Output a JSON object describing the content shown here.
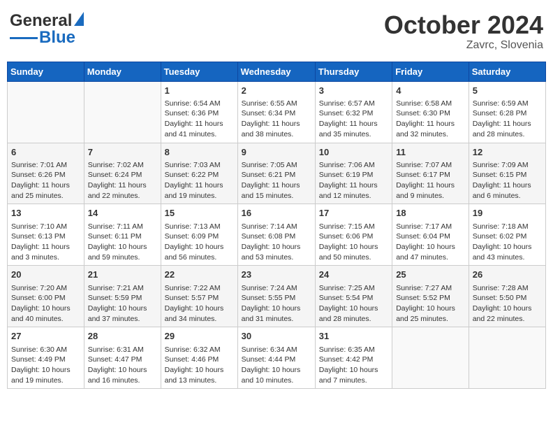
{
  "header": {
    "logo_general": "General",
    "logo_blue": "Blue",
    "month_title": "October 2024",
    "location": "Zavrc, Slovenia"
  },
  "days_of_week": [
    "Sunday",
    "Monday",
    "Tuesday",
    "Wednesday",
    "Thursday",
    "Friday",
    "Saturday"
  ],
  "weeks": [
    [
      {
        "day": "",
        "info": ""
      },
      {
        "day": "",
        "info": ""
      },
      {
        "day": "1",
        "info": "Sunrise: 6:54 AM\nSunset: 6:36 PM\nDaylight: 11 hours and 41 minutes."
      },
      {
        "day": "2",
        "info": "Sunrise: 6:55 AM\nSunset: 6:34 PM\nDaylight: 11 hours and 38 minutes."
      },
      {
        "day": "3",
        "info": "Sunrise: 6:57 AM\nSunset: 6:32 PM\nDaylight: 11 hours and 35 minutes."
      },
      {
        "day": "4",
        "info": "Sunrise: 6:58 AM\nSunset: 6:30 PM\nDaylight: 11 hours and 32 minutes."
      },
      {
        "day": "5",
        "info": "Sunrise: 6:59 AM\nSunset: 6:28 PM\nDaylight: 11 hours and 28 minutes."
      }
    ],
    [
      {
        "day": "6",
        "info": "Sunrise: 7:01 AM\nSunset: 6:26 PM\nDaylight: 11 hours and 25 minutes."
      },
      {
        "day": "7",
        "info": "Sunrise: 7:02 AM\nSunset: 6:24 PM\nDaylight: 11 hours and 22 minutes."
      },
      {
        "day": "8",
        "info": "Sunrise: 7:03 AM\nSunset: 6:22 PM\nDaylight: 11 hours and 19 minutes."
      },
      {
        "day": "9",
        "info": "Sunrise: 7:05 AM\nSunset: 6:21 PM\nDaylight: 11 hours and 15 minutes."
      },
      {
        "day": "10",
        "info": "Sunrise: 7:06 AM\nSunset: 6:19 PM\nDaylight: 11 hours and 12 minutes."
      },
      {
        "day": "11",
        "info": "Sunrise: 7:07 AM\nSunset: 6:17 PM\nDaylight: 11 hours and 9 minutes."
      },
      {
        "day": "12",
        "info": "Sunrise: 7:09 AM\nSunset: 6:15 PM\nDaylight: 11 hours and 6 minutes."
      }
    ],
    [
      {
        "day": "13",
        "info": "Sunrise: 7:10 AM\nSunset: 6:13 PM\nDaylight: 11 hours and 3 minutes."
      },
      {
        "day": "14",
        "info": "Sunrise: 7:11 AM\nSunset: 6:11 PM\nDaylight: 10 hours and 59 minutes."
      },
      {
        "day": "15",
        "info": "Sunrise: 7:13 AM\nSunset: 6:09 PM\nDaylight: 10 hours and 56 minutes."
      },
      {
        "day": "16",
        "info": "Sunrise: 7:14 AM\nSunset: 6:08 PM\nDaylight: 10 hours and 53 minutes."
      },
      {
        "day": "17",
        "info": "Sunrise: 7:15 AM\nSunset: 6:06 PM\nDaylight: 10 hours and 50 minutes."
      },
      {
        "day": "18",
        "info": "Sunrise: 7:17 AM\nSunset: 6:04 PM\nDaylight: 10 hours and 47 minutes."
      },
      {
        "day": "19",
        "info": "Sunrise: 7:18 AM\nSunset: 6:02 PM\nDaylight: 10 hours and 43 minutes."
      }
    ],
    [
      {
        "day": "20",
        "info": "Sunrise: 7:20 AM\nSunset: 6:00 PM\nDaylight: 10 hours and 40 minutes."
      },
      {
        "day": "21",
        "info": "Sunrise: 7:21 AM\nSunset: 5:59 PM\nDaylight: 10 hours and 37 minutes."
      },
      {
        "day": "22",
        "info": "Sunrise: 7:22 AM\nSunset: 5:57 PM\nDaylight: 10 hours and 34 minutes."
      },
      {
        "day": "23",
        "info": "Sunrise: 7:24 AM\nSunset: 5:55 PM\nDaylight: 10 hours and 31 minutes."
      },
      {
        "day": "24",
        "info": "Sunrise: 7:25 AM\nSunset: 5:54 PM\nDaylight: 10 hours and 28 minutes."
      },
      {
        "day": "25",
        "info": "Sunrise: 7:27 AM\nSunset: 5:52 PM\nDaylight: 10 hours and 25 minutes."
      },
      {
        "day": "26",
        "info": "Sunrise: 7:28 AM\nSunset: 5:50 PM\nDaylight: 10 hours and 22 minutes."
      }
    ],
    [
      {
        "day": "27",
        "info": "Sunrise: 6:30 AM\nSunset: 4:49 PM\nDaylight: 10 hours and 19 minutes."
      },
      {
        "day": "28",
        "info": "Sunrise: 6:31 AM\nSunset: 4:47 PM\nDaylight: 10 hours and 16 minutes."
      },
      {
        "day": "29",
        "info": "Sunrise: 6:32 AM\nSunset: 4:46 PM\nDaylight: 10 hours and 13 minutes."
      },
      {
        "day": "30",
        "info": "Sunrise: 6:34 AM\nSunset: 4:44 PM\nDaylight: 10 hours and 10 minutes."
      },
      {
        "day": "31",
        "info": "Sunrise: 6:35 AM\nSunset: 4:42 PM\nDaylight: 10 hours and 7 minutes."
      },
      {
        "day": "",
        "info": ""
      },
      {
        "day": "",
        "info": ""
      }
    ]
  ]
}
